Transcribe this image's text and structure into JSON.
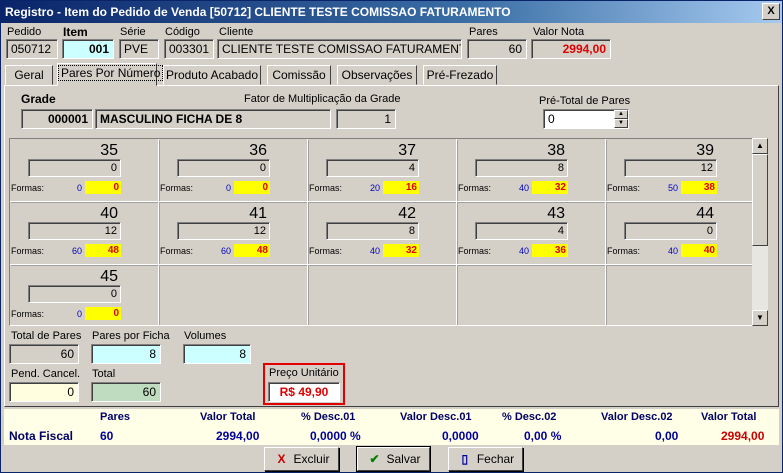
{
  "window": {
    "title": "Registro - Item do Pedido de Venda  [50712] CLIENTE TESTE COMISSAO FATURAMENTO",
    "close_glyph": "X"
  },
  "header": {
    "pedido_label": "Pedido",
    "pedido_value": "050712",
    "item_label": "Item",
    "item_value": "001",
    "serie_label": "Série",
    "serie_value": "PVE",
    "codigo_label": "Código",
    "codigo_value": "003301",
    "cliente_label": "Cliente",
    "cliente_value": "CLIENTE TESTE COMISSAO FATURAMENTO",
    "pares_label": "Pares",
    "pares_value": "60",
    "valor_nota_label": "Valor Nota",
    "valor_nota_value": "2994,00"
  },
  "tabs": [
    "Geral",
    "Pares Por Número",
    "Produto Acabado",
    "Comissão",
    "Observações",
    "Pré-Frezado"
  ],
  "grade": {
    "label": "Grade",
    "code": "000001",
    "name": "MASCULINO FICHA DE 8",
    "fator_label": "Fator de Multiplicação da Grade",
    "fator_value": "1",
    "pre_total_label": "Pré-Total de Pares",
    "pre_total_value": "0"
  },
  "sizes": [
    {
      "size": "35",
      "qty": "0",
      "formas_label": "Formas:",
      "f1": "0",
      "f2": "0"
    },
    {
      "size": "36",
      "qty": "0",
      "formas_label": "Formas:",
      "f1": "0",
      "f2": "0"
    },
    {
      "size": "37",
      "qty": "4",
      "formas_label": "Formas:",
      "f1": "20",
      "f2": "16"
    },
    {
      "size": "38",
      "qty": "8",
      "formas_label": "Formas:",
      "f1": "40",
      "f2": "32"
    },
    {
      "size": "39",
      "qty": "12",
      "formas_label": "Formas:",
      "f1": "50",
      "f2": "38"
    },
    {
      "size": "40",
      "qty": "12",
      "formas_label": "Formas:",
      "f1": "60",
      "f2": "48"
    },
    {
      "size": "41",
      "qty": "12",
      "formas_label": "Formas:",
      "f1": "60",
      "f2": "48"
    },
    {
      "size": "42",
      "qty": "8",
      "formas_label": "Formas:",
      "f1": "40",
      "f2": "32"
    },
    {
      "size": "43",
      "qty": "4",
      "formas_label": "Formas:",
      "f1": "40",
      "f2": "36"
    },
    {
      "size": "44",
      "qty": "0",
      "formas_label": "Formas:",
      "f1": "40",
      "f2": "40"
    },
    {
      "size": "45",
      "qty": "0",
      "formas_label": "Formas:",
      "f1": "0",
      "f2": "0"
    }
  ],
  "totals": {
    "total_pares_label": "Total de Pares",
    "total_pares_value": "60",
    "pares_ficha_label": "Pares por Ficha",
    "pares_ficha_value": "8",
    "volumes_label": "Volumes",
    "volumes_value": "8",
    "pend_cancel_label": "Pend. Cancel.",
    "pend_cancel_value": "0",
    "total_label": "Total",
    "total_value": "60",
    "preco_label": "Preço Unitário",
    "preco_value": "R$ 49,90"
  },
  "footer": {
    "headers": [
      "Pares",
      "Valor Total",
      "% Desc.01",
      "Valor Desc.01",
      "% Desc.02",
      "Valor Desc.02",
      "Valor Total"
    ],
    "row_label": "Nota Fiscal",
    "values": [
      "60",
      "2994,00",
      "0,0000 %",
      "0,0000",
      "0,00 %",
      "0,00",
      "2994,00"
    ]
  },
  "buttons": {
    "excluir": "Excluir",
    "excluir_icon": "X",
    "salvar": "Salvar",
    "salvar_icon": "✔",
    "fechar": "Fechar",
    "fechar_icon": "▯"
  },
  "colors": {
    "accent_red": "#e00000",
    "footer_blue": "#000099",
    "yellow": "#ffff00"
  }
}
